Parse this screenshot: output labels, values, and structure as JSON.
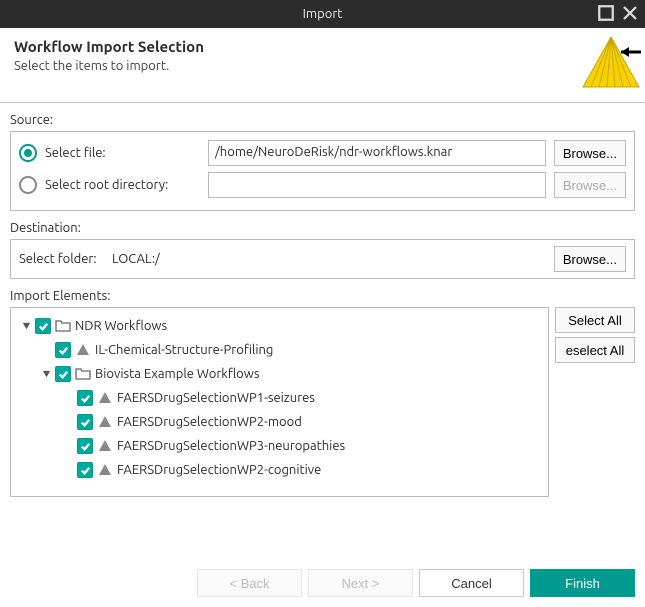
{
  "window": {
    "title": "Import"
  },
  "header": {
    "title": "Workflow Import Selection",
    "subtitle": "Select the items to import."
  },
  "source": {
    "label": "Source:",
    "file_label": "Select file:",
    "file_value": "/home/NeuroDeRisk/ndr-workflows.knar",
    "dir_label": "Select root directory:",
    "browse": "Browse...",
    "browse_disabled": "Browse..."
  },
  "destination": {
    "label": "Destination:",
    "folder_label": "Select folder:",
    "folder_value": "LOCAL:/",
    "browse": "Browse..."
  },
  "elements": {
    "label": "Import Elements:",
    "select_all": "Select All",
    "deselect_all": "eselect All",
    "tree": {
      "root": "NDR Workflows",
      "item1": "IL-Chemical-Structure-Profiling",
      "folder2": "Biovista Example Workflows",
      "item2a": "FAERSDrugSelectionWP1-seizures",
      "item2b": "FAERSDrugSelectionWP2-mood",
      "item2c": "FAERSDrugSelectionWP3-neuropathies",
      "item2d": "FAERSDrugSelectionWP2-cognitive"
    }
  },
  "footer": {
    "back": "< Back",
    "next": "Next >",
    "cancel": "Cancel",
    "finish": "Finish"
  }
}
